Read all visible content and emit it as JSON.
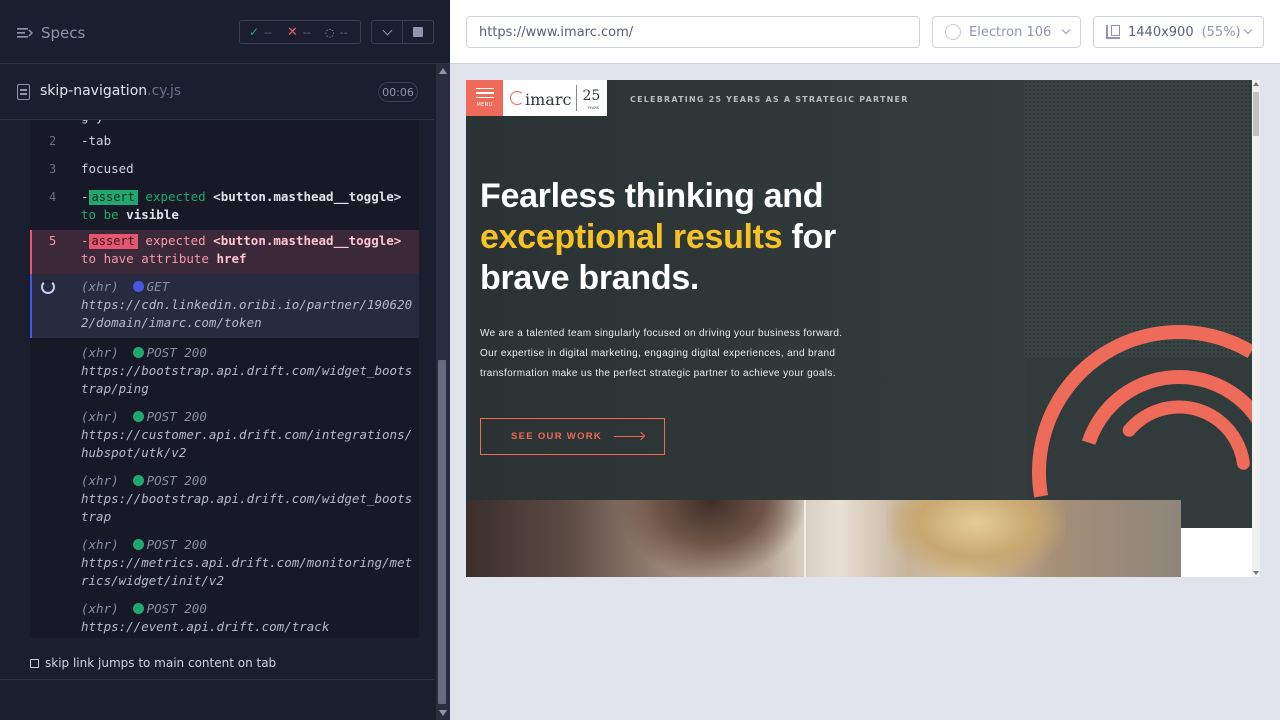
{
  "reporter": {
    "specs_label": "Specs",
    "stats": {
      "passed": "--",
      "failed": "--",
      "pending": "--"
    },
    "file": {
      "name": "skip-navigation",
      "ext": ".cy.js",
      "duration": "00:06"
    },
    "commands": [
      {
        "num": "2",
        "text": "-tab"
      },
      {
        "num": "3",
        "text": "focused"
      },
      {
        "num": "4",
        "badge": "assert",
        "expected": "expected",
        "subject": "<button.masthead__toggle>",
        "tail": "to be",
        "value": "visible"
      },
      {
        "num": "5",
        "badge": "assert",
        "expected": "expected",
        "subject": "<button.masthead__toggle>",
        "tail": "to have attribute",
        "value": "href"
      }
    ],
    "requests": [
      {
        "type": "(xhr)",
        "method": "GET",
        "status": "",
        "url": "https://cdn.linkedin.oribi.io/partner/1906202/domain/imarc.com/token"
      },
      {
        "type": "(xhr)",
        "method": "POST",
        "status": "200",
        "url": "https://bootstrap.api.drift.com/widget_bootstrap/ping"
      },
      {
        "type": "(xhr)",
        "method": "POST",
        "status": "200",
        "url": "https://customer.api.drift.com/integrations/hubspot/utk/v2"
      },
      {
        "type": "(xhr)",
        "method": "POST",
        "status": "200",
        "url": "https://bootstrap.api.drift.com/widget_bootstrap"
      },
      {
        "type": "(xhr)",
        "method": "POST",
        "status": "200",
        "url": "https://metrics.api.drift.com/monitoring/metrics/widget/init/v2"
      },
      {
        "type": "(xhr)",
        "method": "POST",
        "status": "200",
        "url": "https://event.api.drift.com/track"
      }
    ],
    "test_title": "skip link jumps to main content on tab"
  },
  "runner": {
    "url": "https://www.imarc.com/",
    "browser": "Electron 106",
    "viewport": "1440x900",
    "scale": "(55%)"
  },
  "aut": {
    "menu_label": "MENU",
    "logo_text": "imarc",
    "logo_25": "25",
    "logo_years": "YEARS",
    "celebrate": "CELEBRATING 25 YEARS AS A STRATEGIC PARTNER",
    "headline_1": "Fearless thinking and",
    "headline_hl": "exceptional results",
    "headline_2": " for",
    "headline_3": "brave brands.",
    "paragraph": "We are a talented team singularly focused on driving your business forward. Our expertise in digital marketing, engaging digital experiences, and brand transformation make us the perfect strategic partner to achieve your goals.",
    "cta": "SEE OUR WORK"
  },
  "colors": {
    "pass": "#1fa971",
    "fail": "#e45770",
    "pending": "#4956e3",
    "brand_coral": "#ee6a59",
    "brand_yellow": "#f5c227"
  }
}
